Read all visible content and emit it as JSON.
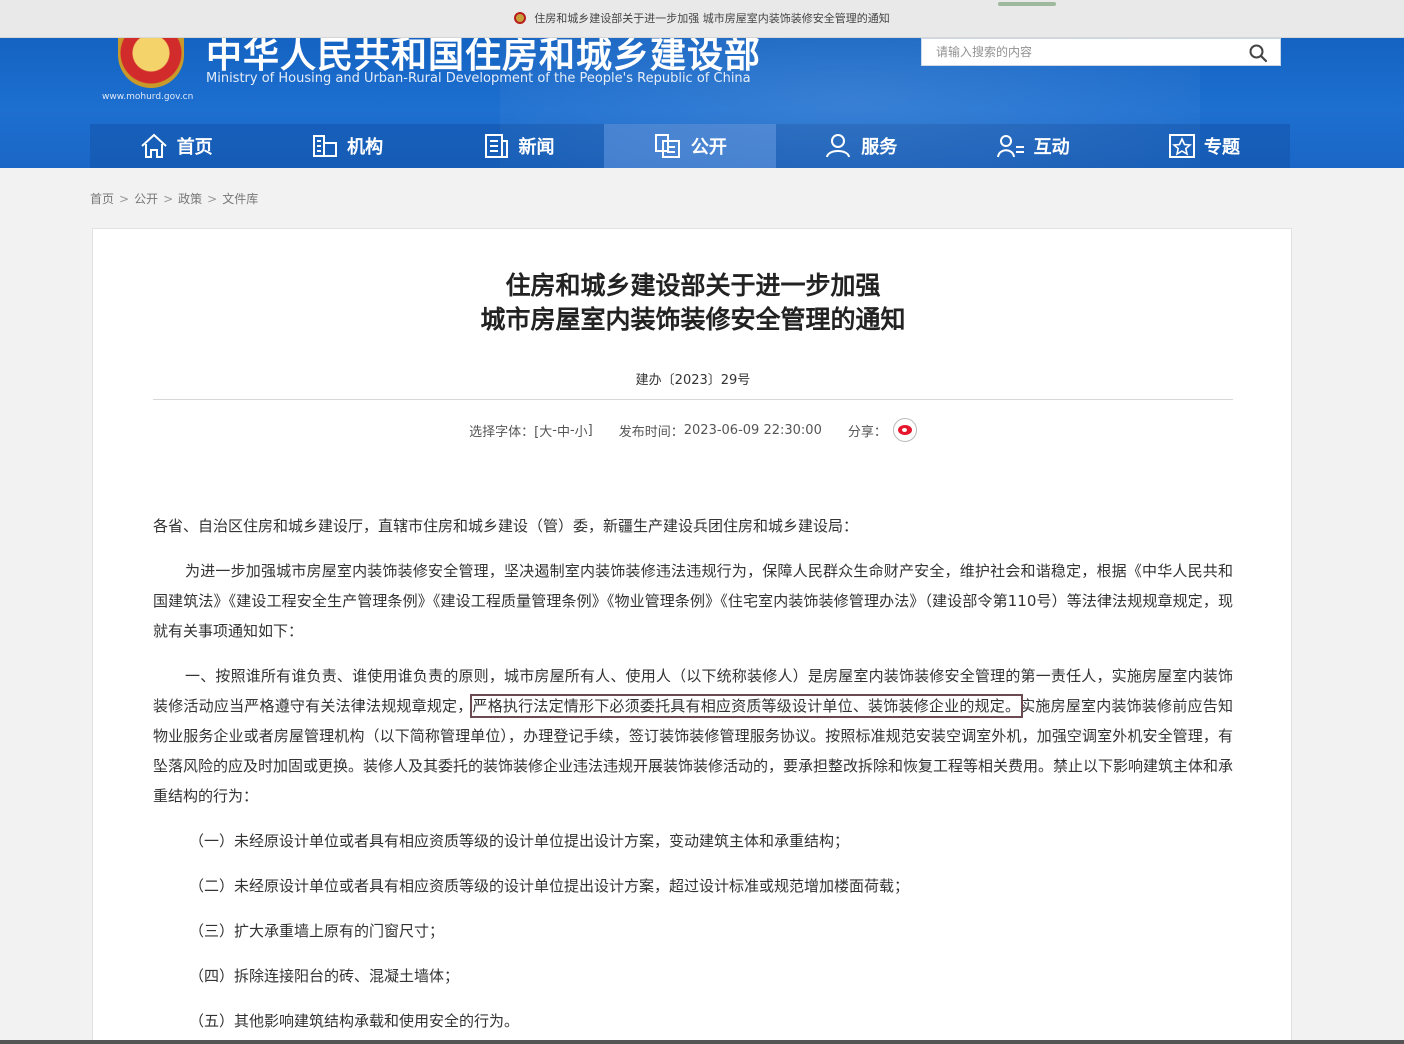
{
  "browser": {
    "tab_title": "住房和城乡建设部关于进一步加强 城市房屋室内装饰装修安全管理的通知"
  },
  "header": {
    "site_url": "www.mohurd.gov.cn",
    "title": "中华人民共和国住房和城乡建设部",
    "subtitle": "Ministry of Housing and Urban-Rural Development of the People's Republic of China",
    "search_placeholder": "请输入搜索的内容"
  },
  "nav": {
    "items": [
      {
        "label": "首页",
        "icon": "home-icon"
      },
      {
        "label": "机构",
        "icon": "building-icon"
      },
      {
        "label": "新闻",
        "icon": "news-icon"
      },
      {
        "label": "公开",
        "icon": "document-icon",
        "active": true
      },
      {
        "label": "服务",
        "icon": "user-service-icon"
      },
      {
        "label": "互动",
        "icon": "interaction-icon"
      },
      {
        "label": "专题",
        "icon": "star-topic-icon"
      }
    ]
  },
  "breadcrumb": [
    "首页",
    "公开",
    "政策",
    "文件库"
  ],
  "article": {
    "title_line1": "住房和城乡建设部关于进一步加强",
    "title_line2": "城市房屋室内装饰装修安全管理的通知",
    "doc_number": "建办〔2023〕29号",
    "font_select_label": "选择字体：[",
    "font_large": "大",
    "font_medium": "中",
    "font_small": "小",
    "font_select_close": "]",
    "publish_label": "发布时间：",
    "publish_time": "2023-06-09 22:30:00",
    "share_label": "分享：",
    "salutation": "各省、自治区住房和城乡建设厅，直辖市住房和城乡建设（管）委，新疆生产建设兵团住房和城乡建设局：",
    "intro": "为进一步加强城市房屋室内装饰装修安全管理，坚决遏制室内装饰装修违法违规行为，保障人民群众生命财产安全，维护社会和谐稳定，根据《中华人民共和国建筑法》《建设工程安全生产管理条例》《建设工程质量管理条例》《物业管理条例》《住宅室内装饰装修管理办法》（建设部令第110号）等法律法规规章规定，现就有关事项通知如下：",
    "section1_before": "一、按照谁所有谁负责、谁使用谁负责的原则，城市房屋所有人、使用人（以下统称装修人）是房屋室内装饰装修安全管理的第一责任人，实施房屋室内装饰装修活动应当严格遵守有关法律法规规章规定，",
    "section1_highlight": "严格执行法定情形下必须委托具有相应资质等级设计单位、装饰装修企业的规定。",
    "section1_after": "实施房屋室内装饰装修前应告知物业服务企业或者房屋管理机构（以下简称管理单位），办理登记手续，签订装饰装修管理服务协议。按照标准规范安装空调室外机，加强空调室外机安全管理，有坠落风险的应及时加固或更换。装修人及其委托的装饰装修企业违法违规开展装饰装修活动的，要承担整改拆除和恢复工程等相关费用。禁止以下影响建筑主体和承重结构的行为：",
    "items": [
      "（一）未经原设计单位或者具有相应资质等级的设计单位提出设计方案，变动建筑主体和承重结构；",
      "（二）未经原设计单位或者具有相应资质等级的设计单位提出设计方案，超过设计标准或规范增加楼面荷载；",
      "（三）扩大承重墙上原有的门窗尺寸；",
      "（四）拆除连接阳台的砖、混凝土墙体；",
      "（五）其他影响建筑结构承载和使用安全的行为。"
    ]
  },
  "colors": {
    "header_blue": "#1d6fd0",
    "highlight_border": "#6b4a52"
  }
}
